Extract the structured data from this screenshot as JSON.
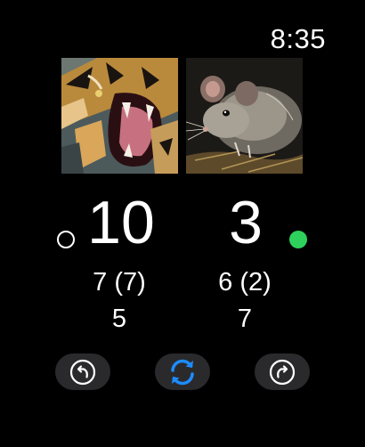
{
  "status_bar": {
    "time": "8:35"
  },
  "players": [
    {
      "name_icon": "tiger-image",
      "score": "10",
      "stat_primary": "7 (7)",
      "stat_secondary": "5",
      "serving": false
    },
    {
      "name_icon": "mouse-image",
      "score": "3",
      "stat_primary": "6 (2)",
      "stat_secondary": "7",
      "serving": true
    }
  ],
  "controls": {
    "undo_icon": "undo-arrow-icon",
    "swap_icon": "swap-sync-icon",
    "redo_icon": "redo-arrow-icon"
  },
  "colors": {
    "background": "#000000",
    "accent_active": "#2ed15c",
    "sync_blue": "#1e8bff",
    "button_bg": "#2a2a2c"
  }
}
